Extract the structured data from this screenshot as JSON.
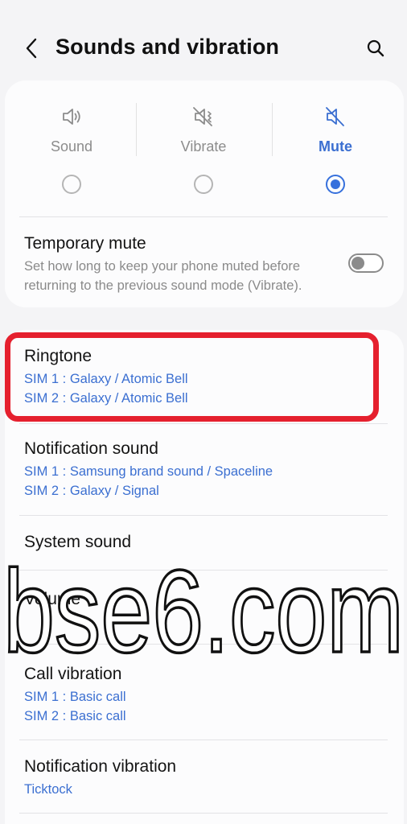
{
  "header": {
    "title": "Sounds and vibration"
  },
  "sound_modes": [
    {
      "label": "Sound",
      "icon": "speaker-icon",
      "selected": false
    },
    {
      "label": "Vibrate",
      "icon": "vibrate-icon",
      "selected": false
    },
    {
      "label": "Mute",
      "icon": "mute-icon",
      "selected": true
    }
  ],
  "temporary_mute": {
    "title": "Temporary mute",
    "description_line1": "Set how long to keep your phone muted before",
    "description_line2": "returning to the previous sound mode (Vibrate).",
    "enabled": false
  },
  "settings": [
    {
      "title": "Ringtone",
      "sub": [
        "SIM 1 : Galaxy / Atomic Bell",
        "SIM 2 : Galaxy / Atomic Bell"
      ]
    },
    {
      "title": "Notification sound",
      "sub": [
        "SIM 1 : Samsung brand sound / Spaceline",
        "SIM 2 : Galaxy / Signal"
      ]
    },
    {
      "title": "System sound",
      "sub": []
    },
    {
      "title": "Volume",
      "sub": []
    },
    {
      "title": "Call vibration",
      "sub": [
        "SIM 1 : Basic call",
        "SIM 2 : Basic call"
      ]
    },
    {
      "title": "Notification vibration",
      "sub": [
        "Ticktock"
      ]
    }
  ],
  "watermark": {
    "text": "bse6.com"
  },
  "colors": {
    "accent": "#3670dc",
    "highlight": "#e5202e",
    "background": "#f4f4f6"
  }
}
